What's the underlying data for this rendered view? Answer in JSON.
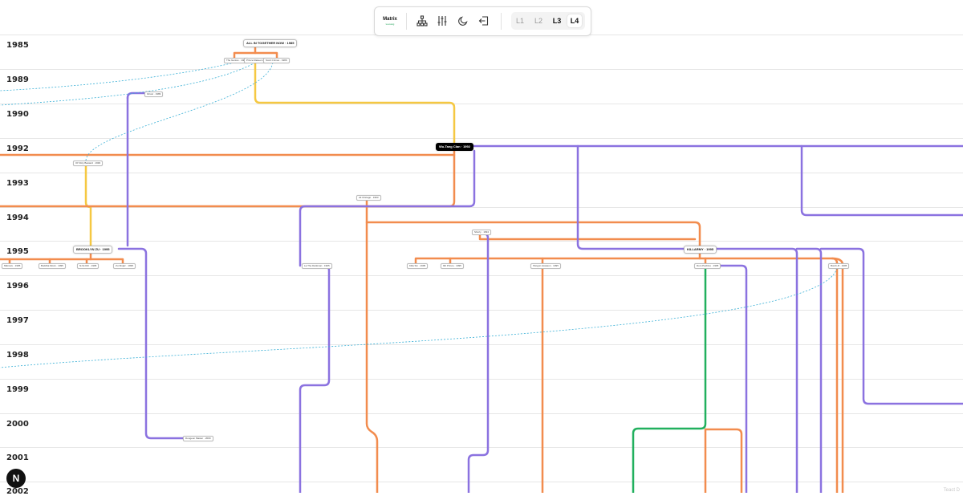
{
  "years": [
    "1985",
    "1989",
    "1990",
    "1992",
    "1993",
    "1994",
    "1995",
    "1996",
    "1997",
    "1998",
    "1999",
    "2000",
    "2001",
    "2002"
  ],
  "group_nodes": {
    "all_in_together": "ALL IN TOGETHER NOW · 1985",
    "wu_tang_clan": "Wu-Tang Clan · 1992",
    "brooklyn_zu": "BROOKLYN ZU · 1995",
    "killarmy": "KILLARMY · 1995"
  },
  "nodes": {
    "n1": "The Genius · 1989",
    "n2": "Prince Rakeem · 1989",
    "n3": "Scott Crimes · 1989",
    "n4": "Ghost · 1989",
    "n5": "Ol' Dirty Bastard · 1993",
    "n6": "Ali Chicago · 1993",
    "n7": "Shorty · 1994",
    "n8": "Mikrowv · 1995",
    "n9": "Buddha Monk · 1995",
    "n10": "NJ E Dirt · 1995",
    "n11": "Zu Ninjaz · 1995",
    "n12": "La The Darkman · 1995",
    "n13": "Killa Sin · 1995",
    "n14": "9th Prince · 1995",
    "n15": "Shogun Assason · 1995",
    "n16": "Dom Pachino · 1995",
    "n17": "Bomb-R · 1995",
    "n18": "Dungeon Master · 2000"
  },
  "toolbar": {
    "logo_title": "Matrix",
    "logo_sub": "wu-tang",
    "levels": [
      "L1",
      "L2",
      "L3",
      "L4"
    ],
    "active_level": "L4"
  },
  "badge": "N",
  "footer": "Teact D",
  "colors": {
    "orange": "#f28c4e",
    "purple": "#8b72e0",
    "yellow": "#f5c842",
    "green": "#21b05e",
    "dashed": "#3ab0d6"
  }
}
